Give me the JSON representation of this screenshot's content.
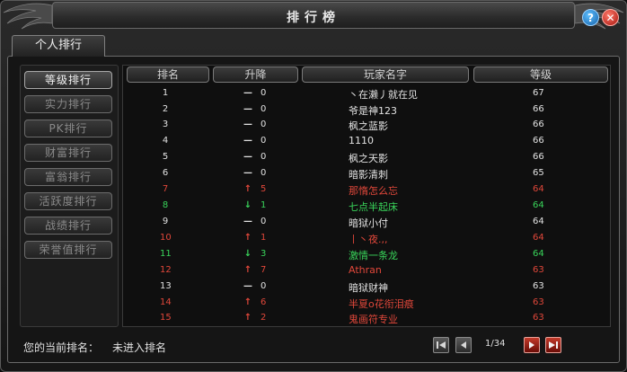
{
  "window": {
    "title": "排行榜"
  },
  "tab": {
    "label": "个人排行"
  },
  "sidebar": {
    "items": [
      {
        "label": "等级排行",
        "active": true
      },
      {
        "label": "实力排行",
        "active": false
      },
      {
        "label": "PK排行",
        "active": false
      },
      {
        "label": "财富排行",
        "active": false
      },
      {
        "label": "富翁排行",
        "active": false
      },
      {
        "label": "活跃度排行",
        "active": false
      },
      {
        "label": "战绩排行",
        "active": false
      },
      {
        "label": "荣誉值排行",
        "active": false
      }
    ]
  },
  "table": {
    "headers": {
      "rank": "排名",
      "change": "升降",
      "name": "玩家名字",
      "level": "等级"
    },
    "rows": [
      {
        "rank": "1",
        "arrow": "—",
        "change": "0",
        "name": "丶在濑丿就在见",
        "level": "67",
        "tone": "white"
      },
      {
        "rank": "2",
        "arrow": "—",
        "change": "0",
        "name": "爷是神123",
        "level": "66",
        "tone": "white"
      },
      {
        "rank": "3",
        "arrow": "—",
        "change": "0",
        "name": "枫之蓝影",
        "level": "66",
        "tone": "white"
      },
      {
        "rank": "4",
        "arrow": "—",
        "change": "0",
        "name": "1110",
        "level": "66",
        "tone": "white"
      },
      {
        "rank": "5",
        "arrow": "—",
        "change": "0",
        "name": "枫之天影",
        "level": "66",
        "tone": "white"
      },
      {
        "rank": "6",
        "arrow": "—",
        "change": "0",
        "name": "暗影清刺",
        "level": "65",
        "tone": "white"
      },
      {
        "rank": "7",
        "arrow": "↑",
        "change": "5",
        "name": "那惰怎么忘",
        "level": "64",
        "tone": "red"
      },
      {
        "rank": "8",
        "arrow": "↓",
        "change": "1",
        "name": "七点半起床",
        "level": "64",
        "tone": "green"
      },
      {
        "rank": "9",
        "arrow": "—",
        "change": "0",
        "name": "暗狱小付",
        "level": "64",
        "tone": "white"
      },
      {
        "rank": "10",
        "arrow": "↑",
        "change": "1",
        "name": "丨丶夜.,,",
        "level": "64",
        "tone": "red"
      },
      {
        "rank": "11",
        "arrow": "↓",
        "change": "3",
        "name": "激情一条龙",
        "level": "64",
        "tone": "green"
      },
      {
        "rank": "12",
        "arrow": "↑",
        "change": "7",
        "name": "Athran",
        "level": "63",
        "tone": "red"
      },
      {
        "rank": "13",
        "arrow": "—",
        "change": "0",
        "name": "暗狱财神",
        "level": "63",
        "tone": "white"
      },
      {
        "rank": "14",
        "arrow": "↑",
        "change": "6",
        "name": "半夏o花衔泪痕",
        "level": "63",
        "tone": "red"
      },
      {
        "rank": "15",
        "arrow": "↑",
        "change": "2",
        "name": "鬼画符专业",
        "level": "63",
        "tone": "red"
      }
    ]
  },
  "footer": {
    "current_rank_label": "您的当前排名：",
    "current_rank_value": "未进入排名",
    "page": "1/34"
  },
  "icons": {
    "help": "?",
    "close": "✕"
  },
  "colors": {
    "up": "#e0473a",
    "down": "#39d45a",
    "neutral": "#e2e2e2"
  }
}
